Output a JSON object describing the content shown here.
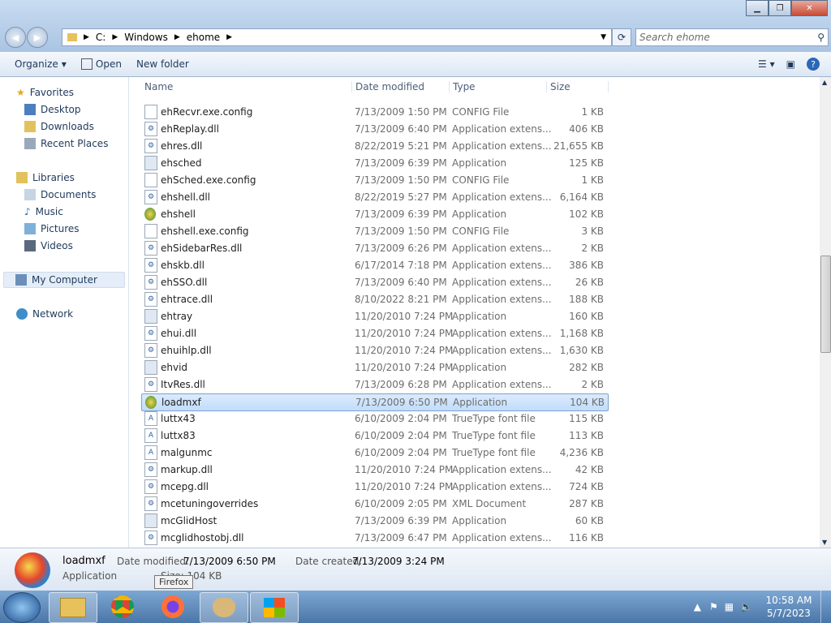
{
  "address": {
    "segments": [
      "C:",
      "Windows",
      "ehome"
    ]
  },
  "search": {
    "placeholder": "Search ehome"
  },
  "toolbar": {
    "organize": "Organize",
    "open": "Open",
    "new_folder": "New folder"
  },
  "sidebar": {
    "favorites": "Favorites",
    "desktop": "Desktop",
    "downloads": "Downloads",
    "recent": "Recent Places",
    "libraries": "Libraries",
    "documents": "Documents",
    "music": "Music",
    "pictures": "Pictures",
    "videos": "Videos",
    "mycomputer": "My Computer",
    "network": "Network"
  },
  "columns": {
    "name": "Name",
    "date": "Date modified",
    "type": "Type",
    "size": "Size"
  },
  "files": [
    {
      "name": "ehRecvr.exe.config",
      "date": "7/13/2009 1:50 PM",
      "type": "CONFIG File",
      "size": "1 KB",
      "icon": "config"
    },
    {
      "name": "ehReplay.dll",
      "date": "7/13/2009 6:40 PM",
      "type": "Application extens...",
      "size": "406 KB",
      "icon": "dll"
    },
    {
      "name": "ehres.dll",
      "date": "8/22/2019 5:21 PM",
      "type": "Application extens...",
      "size": "21,655 KB",
      "icon": "dll"
    },
    {
      "name": "ehsched",
      "date": "7/13/2009 6:39 PM",
      "type": "Application",
      "size": "125 KB",
      "icon": "app"
    },
    {
      "name": "ehSched.exe.config",
      "date": "7/13/2009 1:50 PM",
      "type": "CONFIG File",
      "size": "1 KB",
      "icon": "config"
    },
    {
      "name": "ehshell.dll",
      "date": "8/22/2019 5:27 PM",
      "type": "Application extens...",
      "size": "6,164 KB",
      "icon": "dll"
    },
    {
      "name": "ehshell",
      "date": "7/13/2009 6:39 PM",
      "type": "Application",
      "size": "102 KB",
      "icon": "globe"
    },
    {
      "name": "ehshell.exe.config",
      "date": "7/13/2009 1:50 PM",
      "type": "CONFIG File",
      "size": "3 KB",
      "icon": "config"
    },
    {
      "name": "ehSidebarRes.dll",
      "date": "7/13/2009 6:26 PM",
      "type": "Application extens...",
      "size": "2 KB",
      "icon": "dll"
    },
    {
      "name": "ehskb.dll",
      "date": "6/17/2014 7:18 PM",
      "type": "Application extens...",
      "size": "386 KB",
      "icon": "dll"
    },
    {
      "name": "ehSSO.dll",
      "date": "7/13/2009 6:40 PM",
      "type": "Application extens...",
      "size": "26 KB",
      "icon": "dll"
    },
    {
      "name": "ehtrace.dll",
      "date": "8/10/2022 8:21 PM",
      "type": "Application extens...",
      "size": "188 KB",
      "icon": "dll"
    },
    {
      "name": "ehtray",
      "date": "11/20/2010 7:24 PM",
      "type": "Application",
      "size": "160 KB",
      "icon": "app"
    },
    {
      "name": "ehui.dll",
      "date": "11/20/2010 7:24 PM",
      "type": "Application extens...",
      "size": "1,168 KB",
      "icon": "dll"
    },
    {
      "name": "ehuihlp.dll",
      "date": "11/20/2010 7:24 PM",
      "type": "Application extens...",
      "size": "1,630 KB",
      "icon": "dll"
    },
    {
      "name": "ehvid",
      "date": "11/20/2010 7:24 PM",
      "type": "Application",
      "size": "282 KB",
      "icon": "app"
    },
    {
      "name": "ItvRes.dll",
      "date": "7/13/2009 6:28 PM",
      "type": "Application extens...",
      "size": "2 KB",
      "icon": "dll"
    },
    {
      "name": "loadmxf",
      "date": "7/13/2009 6:50 PM",
      "type": "Application",
      "size": "104 KB",
      "icon": "globe",
      "selected": true
    },
    {
      "name": "luttx43",
      "date": "6/10/2009 2:04 PM",
      "type": "TrueType font file",
      "size": "115 KB",
      "icon": "font"
    },
    {
      "name": "luttx83",
      "date": "6/10/2009 2:04 PM",
      "type": "TrueType font file",
      "size": "113 KB",
      "icon": "font"
    },
    {
      "name": "malgunmc",
      "date": "6/10/2009 2:04 PM",
      "type": "TrueType font file",
      "size": "4,236 KB",
      "icon": "font"
    },
    {
      "name": "markup.dll",
      "date": "11/20/2010 7:24 PM",
      "type": "Application extens...",
      "size": "42 KB",
      "icon": "dll"
    },
    {
      "name": "mcepg.dll",
      "date": "11/20/2010 7:24 PM",
      "type": "Application extens...",
      "size": "724 KB",
      "icon": "dll"
    },
    {
      "name": "mcetuningoverrides",
      "date": "6/10/2009 2:05 PM",
      "type": "XML Document",
      "size": "287 KB",
      "icon": "dll"
    },
    {
      "name": "mcGlidHost",
      "date": "7/13/2009 6:39 PM",
      "type": "Application",
      "size": "60 KB",
      "icon": "app"
    },
    {
      "name": "mcglidhostobj.dll",
      "date": "7/13/2009 6:47 PM",
      "type": "Application extens...",
      "size": "116 KB",
      "icon": "dll"
    }
  ],
  "details": {
    "name": "loadmxf",
    "kind": "Application",
    "mod_label": "Date modified:",
    "mod_value": "7/13/2009 6:50 PM",
    "created_label": "Date created:",
    "created_value": "7/13/2009 3:24 PM",
    "size_text": "Size: 104 KB"
  },
  "tooltip": "Firefox",
  "clock": {
    "time": "10:58 AM",
    "date": "5/7/2023"
  }
}
